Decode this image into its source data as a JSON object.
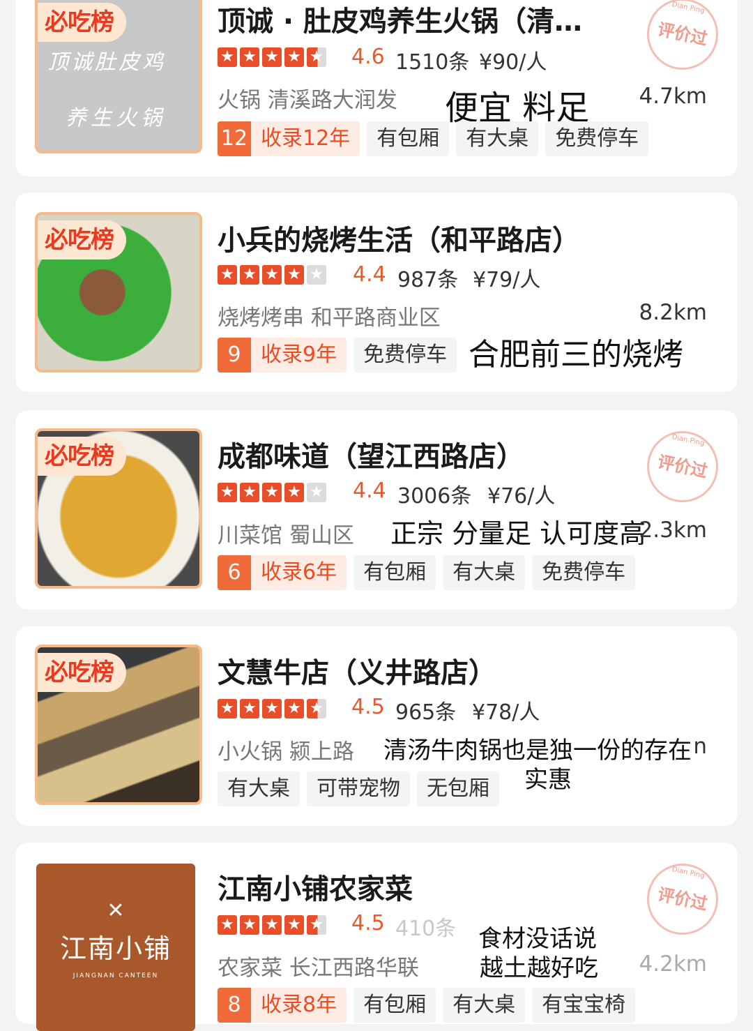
{
  "common": {
    "badge": "必吃榜",
    "stamp_text": "评价过",
    "stamp_small": "Dian Ping"
  },
  "cards": [
    {
      "title": "顶诚 · 肚皮鸡养生火锅（清…",
      "thumb_text_1": "顶诚肚皮鸡",
      "thumb_text_2": "养生火锅",
      "rating": "4.6",
      "reviews": "1510条",
      "price": "¥90/人",
      "category": "火锅 清溪路大润发",
      "distance": "4.7km",
      "year_num": "12",
      "year_label": "收录12年",
      "tags": [
        "有包厢",
        "有大桌",
        "免费停车"
      ],
      "overlay": "便宜 料足"
    },
    {
      "title": "小兵的烧烤生活（和平路店）",
      "rating": "4.4",
      "reviews": "987条",
      "price": "¥79/人",
      "category": "烧烤烤串 和平路商业区",
      "distance": "8.2km",
      "year_num": "9",
      "year_label": "收录9年",
      "tags": [
        "免费停车"
      ],
      "overlay": "合肥前三的烧烤"
    },
    {
      "title": "成都味道（望江西路店）",
      "rating": "4.4",
      "reviews": "3006条",
      "price": "¥76/人",
      "category": "川菜馆 蜀山区",
      "distance": "2.3km",
      "year_num": "6",
      "year_label": "收录6年",
      "tags": [
        "有包厢",
        "有大桌",
        "免费停车"
      ],
      "overlay": "正宗 分量足 认可度高"
    },
    {
      "title": "文慧牛店（义井路店）",
      "rating": "4.5",
      "reviews": "965条",
      "price": "¥78/人",
      "category": "小火锅 颍上路",
      "distance_tail": "n",
      "tags": [
        "有大桌",
        "可带宠物",
        "无包厢"
      ],
      "overlay": "清汤牛肉锅也是独一份的存在",
      "overlay2": "实惠"
    },
    {
      "title": "江南小铺农家菜",
      "logo_cn": "江南小铺",
      "logo_en": "JIANGNAN CANTEEN",
      "rating": "4.5",
      "reviews": "410条",
      "category": "农家菜 长江西路华联",
      "distance": "4.2km",
      "year_num": "8",
      "year_label": "收录8年",
      "tags": [
        "有包厢",
        "有大桌",
        "有宝宝椅"
      ],
      "overlay": "食材没话说",
      "overlay2": "越土越好吃"
    }
  ]
}
